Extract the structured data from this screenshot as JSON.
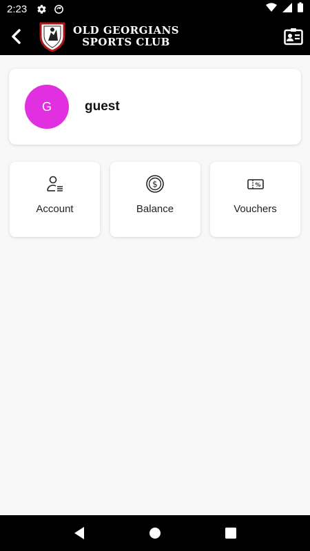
{
  "status_bar": {
    "time": "2:23",
    "icons": [
      "gear-icon",
      "sync-icon",
      "wifi-icon",
      "signal-icon",
      "battery-icon"
    ]
  },
  "app_bar": {
    "club_name_line1": "OLD GEORGIANS",
    "club_name_line2": "SPORTS CLUB",
    "back_icon": "chevron-left-icon",
    "right_icon": "id-card-icon"
  },
  "profile": {
    "avatar_initial": "G",
    "avatar_color": "#e030e0",
    "username": "guest"
  },
  "tiles": [
    {
      "label": "Account",
      "icon": "account-list-icon"
    },
    {
      "label": "Balance",
      "icon": "dollar-coin-icon"
    },
    {
      "label": "Vouchers",
      "icon": "voucher-icon"
    }
  ],
  "nav_bar": {
    "icons": [
      "back-triangle-icon",
      "home-circle-icon",
      "recents-square-icon"
    ]
  }
}
